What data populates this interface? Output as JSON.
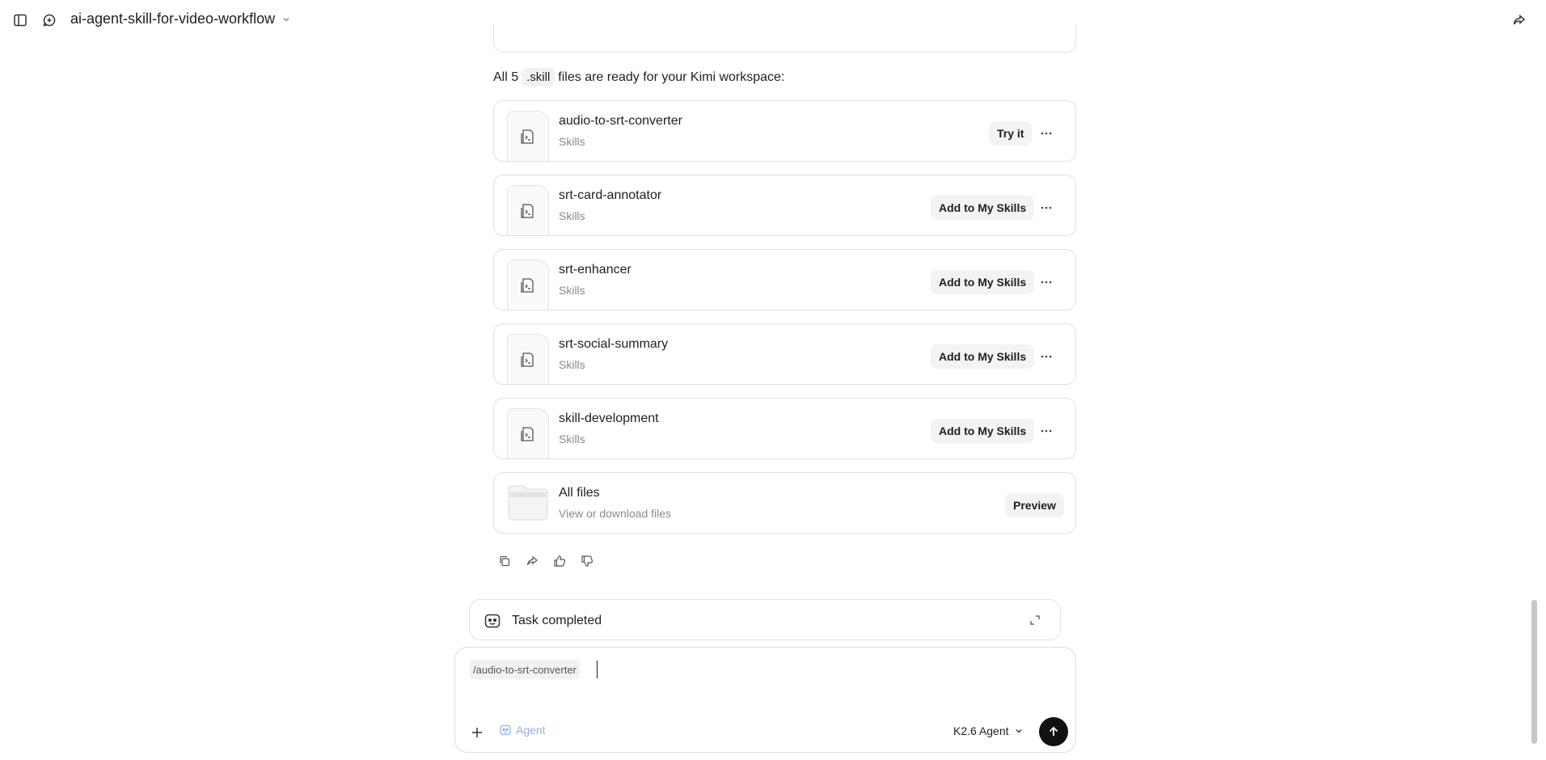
{
  "header": {
    "title": "ai-agent-skill-for-video-workflow",
    "icons": [
      "sidebar-toggle-icon",
      "new-chat-icon",
      "chevron-down-icon",
      "share-icon"
    ]
  },
  "intro": {
    "prefix": "All 5",
    "code": ".skill",
    "suffix": "files are ready for your Kimi workspace:"
  },
  "files": [
    {
      "name": "audio-to-srt-converter",
      "type": "Skills",
      "action": "Try it"
    },
    {
      "name": "srt-card-annotator",
      "type": "Skills",
      "action": "Add to My Skills"
    },
    {
      "name": "srt-enhancer",
      "type": "Skills",
      "action": "Add to My Skills"
    },
    {
      "name": "srt-social-summary",
      "type": "Skills",
      "action": "Add to My Skills"
    },
    {
      "name": "skill-development",
      "type": "Skills",
      "action": "Add to My Skills"
    }
  ],
  "all_files": {
    "name": "All files",
    "subtitle": "View or download files",
    "action": "Preview"
  },
  "task": {
    "label": "Task completed"
  },
  "composer": {
    "command_chip": "/audio-to-srt-converter",
    "agent_label": "Agent",
    "model_label": "K2.6 Agent"
  },
  "colors": {
    "accent_agent": "#8fb3e6",
    "send_button": "#111111",
    "border": "#e0e0e0"
  }
}
